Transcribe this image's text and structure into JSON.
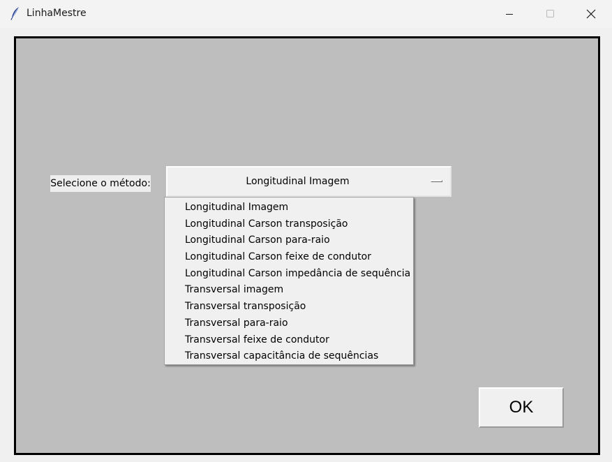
{
  "window": {
    "title": "LinhaMestre",
    "icon": "feather-icon"
  },
  "controls": {
    "minimize_icon": "minimize-icon",
    "maximize_icon": "maximize-icon",
    "close_icon": "close-icon"
  },
  "form": {
    "method_label": "Selecione o método:",
    "selected_method": "Longitudinal Imagem",
    "ok_label": "OK"
  },
  "menu": {
    "items": [
      "Longitudinal Imagem",
      "Longitudinal Carson transposição",
      "Longitudinal Carson para-raio",
      "Longitudinal Carson feixe de condutor",
      "Longitudinal Carson impedância de sequência",
      "Transversal imagem",
      "Transversal transposição",
      "Transversal para-raio",
      "Transversal feixe de condutor",
      "Transversal capacitância de sequências"
    ]
  },
  "colors": {
    "client_background": "#bebebe",
    "border": "#000000",
    "widget_background": "#f0f0f0"
  }
}
